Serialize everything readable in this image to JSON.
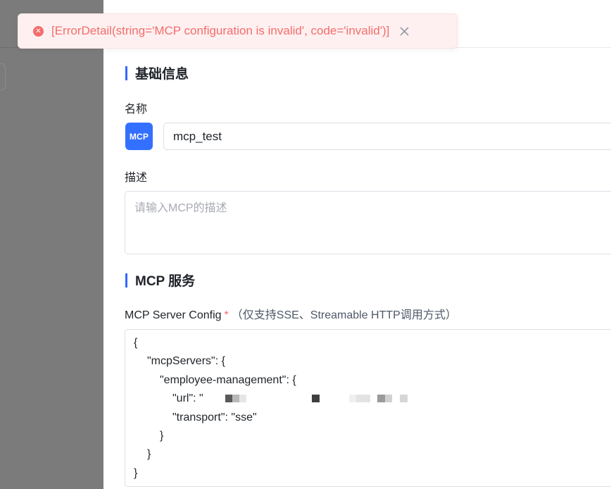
{
  "toast": {
    "message": "[ErrorDetail(string='MCP configuration is invalid', code='invalid')]",
    "icon": "error-circle-icon",
    "close_icon": "close-icon",
    "color": "#f56c6c"
  },
  "basic_info": {
    "section_title": "基础信息",
    "name_label": "名称",
    "logo_text": "MCP",
    "name_value": "mcp_test",
    "desc_label": "描述",
    "desc_placeholder": "请输入MCP的描述"
  },
  "mcp_service": {
    "section_title": "MCP 服务",
    "config_label": "MCP Server Config",
    "required_mark": "*",
    "config_hint": "（仅支持SSE、Streamable HTTP调用方式）",
    "code_lines": [
      "{",
      "\"mcpServers\": {",
      "\"employee-management\": {",
      "\"url\": \"",
      "\"transport\": \"sse\"",
      "}",
      "}",
      "}"
    ]
  },
  "colors": {
    "accent": "#3366ff",
    "logo_bg": "#3370ff",
    "overlay": "#7b7b7b"
  }
}
